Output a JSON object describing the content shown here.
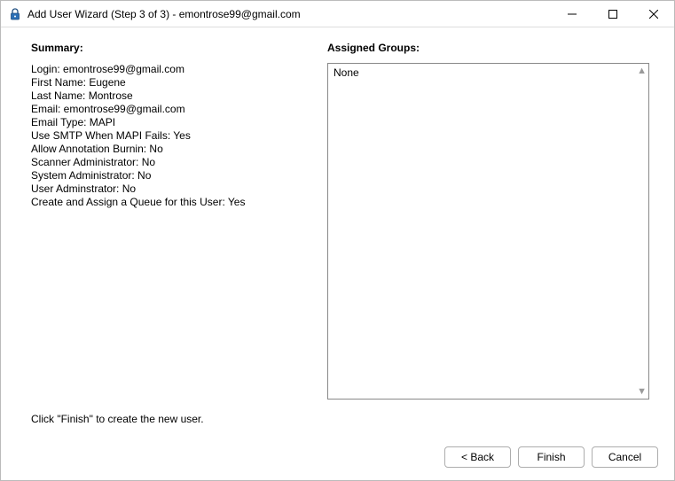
{
  "window": {
    "title": "Add User Wizard (Step 3 of 3) - emontrose99@gmail.com"
  },
  "summary": {
    "heading": "Summary:",
    "items": [
      {
        "label": "Login",
        "value": "emontrose99@gmail.com"
      },
      {
        "label": "First Name",
        "value": "Eugene"
      },
      {
        "label": "Last Name",
        "value": "Montrose"
      },
      {
        "label": "Email",
        "value": "emontrose99@gmail.com"
      },
      {
        "label": "Email Type",
        "value": "MAPI"
      },
      {
        "label": "Use SMTP When MAPI Fails",
        "value": "Yes"
      },
      {
        "label": "Allow Annotation Burnin",
        "value": "No"
      },
      {
        "label": "Scanner Administrator",
        "value": "No"
      },
      {
        "label": "System Administrator",
        "value": "No"
      },
      {
        "label": "User Adminstrator",
        "value": "No"
      },
      {
        "label": "Create and Assign a Queue for this User",
        "value": "Yes"
      }
    ]
  },
  "assigned_groups": {
    "heading": "Assigned Groups:",
    "content": "None"
  },
  "hint": "Click \"Finish\" to create the new user.",
  "buttons": {
    "back": "< Back",
    "finish": "Finish",
    "cancel": "Cancel"
  }
}
